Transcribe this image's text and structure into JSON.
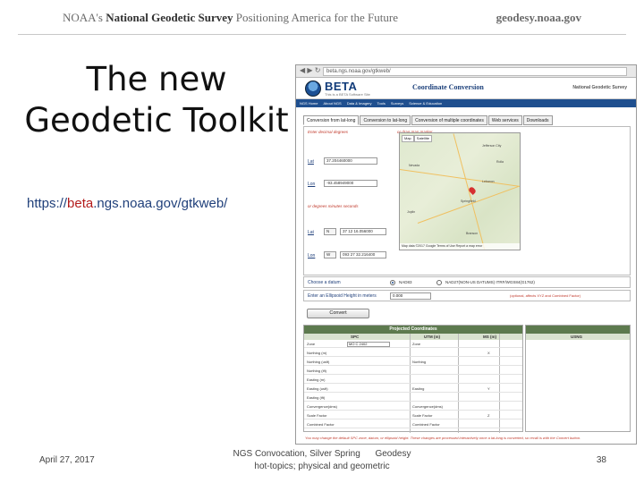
{
  "banner": {
    "left_prefix": "NOAA's ",
    "left_bold": "National Geodetic Survey",
    "left_suffix": " Positioning America for the Future",
    "right": "geodesy.noaa.gov"
  },
  "slide": {
    "title_line1": "The new",
    "title_line2": "Geodetic Toolkit",
    "url_prefix": "https://",
    "url_highlight": "beta",
    "url_suffix": ".ngs.noaa.gov/gtkweb/"
  },
  "footer": {
    "date": "April 27, 2017",
    "center_line1": "NGS Convocation, Silver Spring      Geodesy",
    "center_line2": "hot-topics; physical and geometric",
    "page_number": "38"
  },
  "browser": {
    "nav_arrows": "◀ ▶ ↻",
    "address": "beta.ngs.noaa.gov/gtkweb/",
    "beta_logo": "BETA",
    "beta_sub": "This is a BETA Software Site",
    "site_title": "Coordinate Conversion",
    "site_org": "National Geodetic Survey",
    "nav_items": [
      "NGS Home",
      "About NGS",
      "Data & Imagery",
      "Tools",
      "Surveys",
      "Science & Education"
    ],
    "tabs": [
      {
        "label": "Conversion from lat-long",
        "active": true
      },
      {
        "label": "Conversion to lat-long",
        "active": false
      },
      {
        "label": "Conversion of multiple coordinates",
        "active": false
      },
      {
        "label": "Web services",
        "active": false
      },
      {
        "label": "Downloads",
        "active": false
      }
    ],
    "left_panel": {
      "prompt": "Enter decimal degrees",
      "map_prompt": "or drag map marker",
      "lat_label": "Lat",
      "lat_value": "37.204460000",
      "lon_label": "Lon",
      "lon_value": "-93.458949000",
      "dms_prompt": "or degrees minutes seconds",
      "lat2_label": "Lat",
      "lat2_sel": "N",
      "lat2_value": "37 12 16.056000",
      "lon2_label": "Lon",
      "lon2_sel": "W",
      "lon2_value": "093 27 32.216400"
    },
    "map": {
      "ctrl_map": "Map",
      "ctrl_sat": "Satellite",
      "towns": [
        "Springfield",
        "Joplin",
        "Rolla",
        "Lebanon",
        "Branson",
        "Nevada",
        "Jefferson City"
      ],
      "footer": "Map data ©2017 Google  Terms of Use  Report a map error"
    },
    "datum": {
      "label": "Choose a datum",
      "opt1": "NAD83",
      "opt2": "NAD27(NON-US DATUMS) ITRF/WGS84(G1762)"
    },
    "height": {
      "label": "Enter an Ellipsoid Height in meters",
      "value": "0.000",
      "note": "(optional, affects XYZ and Combined Factor)"
    },
    "convert_label": "Convert",
    "results": {
      "title": "Projected Coordinates",
      "col_spc": "SPC",
      "col_utm": "UTM (m)",
      "col_ms": "MS (m)",
      "col_usng": "USNG",
      "spc_rows": [
        "Zone",
        "Northing (m)",
        "Northing (usft)",
        "Northing (ift)",
        "Easting (m)",
        "Easting (usft)",
        "Easting (ift)",
        "Convergence(dms)",
        "Scale Factor",
        "Combined Factor"
      ],
      "zone_value": "MO C 2402",
      "utm_rows": [
        "Zone",
        "Northing",
        "Easting",
        "Convergence(dms)",
        "Scale Factor",
        "Combined Factor"
      ],
      "ms_markers": [
        "X",
        "Y",
        "Z"
      ]
    },
    "bottom_note": "You may change the default SPC zone, datum, or ellipsoid height. These changes are processed interactively once a lat-long is converted, so recall is with the Convert button."
  }
}
